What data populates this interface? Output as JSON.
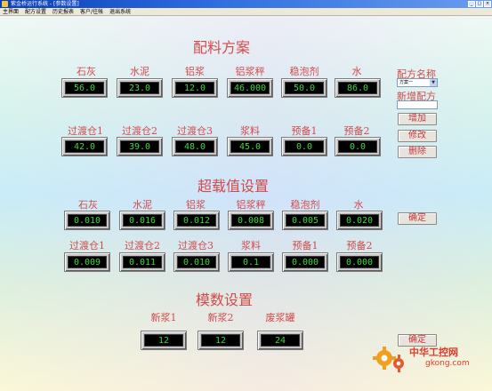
{
  "window": {
    "title": "紫金桥运行系统 - [参数设置]"
  },
  "menu": [
    "主界面",
    "配方设置",
    "历史报表",
    "客户/往帐",
    "退出系统"
  ],
  "recipe": {
    "title": "配料方案",
    "row1": [
      {
        "label": "石灰",
        "value": "56.0"
      },
      {
        "label": "水泥",
        "value": "23.0"
      },
      {
        "label": "铝浆",
        "value": "12.0"
      },
      {
        "label": "铝浆秤",
        "value": "46.000"
      },
      {
        "label": "稳泡剂",
        "value": "50.0"
      },
      {
        "label": "水",
        "value": "86.0"
      }
    ],
    "row2": [
      {
        "label": "过渡仓1",
        "value": "42.0"
      },
      {
        "label": "过渡仓2",
        "value": "39.0"
      },
      {
        "label": "过渡仓3",
        "value": "48.0"
      },
      {
        "label": "浆料",
        "value": "45.0"
      },
      {
        "label": "预备1",
        "value": "0.0"
      },
      {
        "label": "预备2",
        "value": "0.0"
      }
    ]
  },
  "side": {
    "recipe_name_label": "配方名称",
    "recipe_select_value": "方案一",
    "new_recipe_label": "新增配方",
    "add": "增加",
    "modify": "修改",
    "delete": "删除",
    "confirm1": "确定",
    "confirm2": "确定"
  },
  "overload": {
    "title": "超载值设置",
    "row1": [
      {
        "label": "石灰",
        "value": "0.010"
      },
      {
        "label": "水泥",
        "value": "0.016"
      },
      {
        "label": "铝浆",
        "value": "0.012"
      },
      {
        "label": "铝浆秤",
        "value": "0.008"
      },
      {
        "label": "稳泡剂",
        "value": "0.005"
      },
      {
        "label": "水",
        "value": "0.020"
      }
    ],
    "row2": [
      {
        "label": "过渡仓1",
        "value": "0.009"
      },
      {
        "label": "过渡仓2",
        "value": "0.011"
      },
      {
        "label": "过渡仓3",
        "value": "0.010"
      },
      {
        "label": "浆料",
        "value": "0.1"
      },
      {
        "label": "预备1",
        "value": "0.000"
      },
      {
        "label": "预备2",
        "value": "0.000"
      }
    ]
  },
  "modulus": {
    "title": "模数设置",
    "items": [
      {
        "label": "新浆1",
        "value": "12"
      },
      {
        "label": "新浆2",
        "value": "12"
      },
      {
        "label": "废浆罐",
        "value": "24"
      }
    ]
  },
  "watermark": {
    "brand": "中华工控网",
    "site": "gkong.com"
  }
}
